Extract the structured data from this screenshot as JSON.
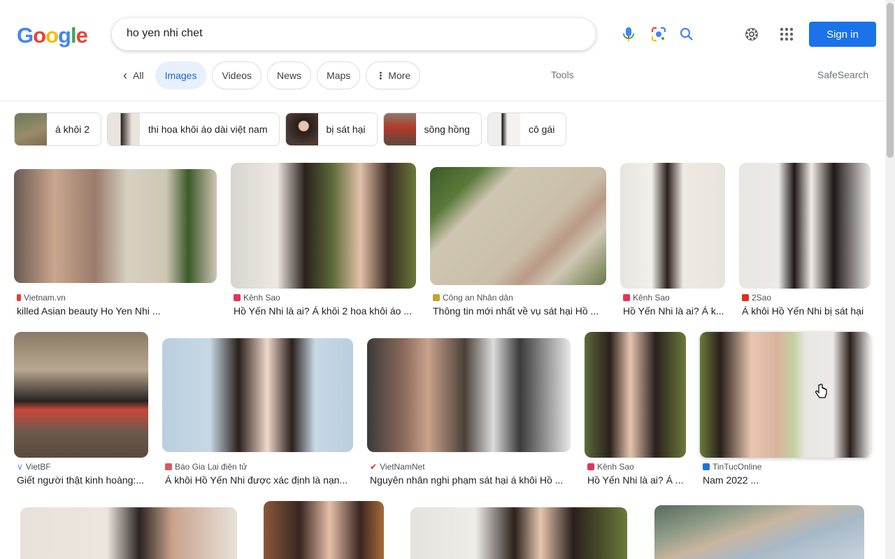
{
  "logo": {
    "letters": [
      "G",
      "o",
      "o",
      "g",
      "l",
      "e"
    ],
    "colors": [
      "#4285F4",
      "#EA4335",
      "#FBBC05",
      "#4285F4",
      "#34A853",
      "#EA4335"
    ]
  },
  "search": {
    "query": "ho yen nhi chet"
  },
  "header": {
    "sign_in": "Sign in"
  },
  "tabs": [
    {
      "label": "All"
    },
    {
      "label": "Images"
    },
    {
      "label": "Videos"
    },
    {
      "label": "News"
    },
    {
      "label": "Maps"
    },
    {
      "label": "More"
    }
  ],
  "tools_label": "Tools",
  "safesearch_label": "SafeSearch",
  "chips": [
    {
      "label": "á khôi 2"
    },
    {
      "label": "thi hoa khôi áo dài việt nam"
    },
    {
      "label": "bị sát hại"
    },
    {
      "label": "sông hồng"
    },
    {
      "label": "cô gái"
    }
  ],
  "results": [
    {
      "source": "Vietnam.vn",
      "title": "killed Asian beauty Ho Yen Nhi ..."
    },
    {
      "source": "Kênh Sao",
      "title": "Hồ Yến Nhi là ai? Á khôi 2 hoa khôi áo ..."
    },
    {
      "source": "Công an Nhân dân",
      "title": "Thông tin mới nhất về vụ sát hại Hồ ..."
    },
    {
      "source": "Kênh Sao",
      "title": "Hồ Yến Nhi là ai? Á k..."
    },
    {
      "source": "2Sao",
      "title": "Á khôi Hồ Yến Nhi bị sát hại"
    },
    {
      "source": "VietBF",
      "title": "Giết người thật kinh hoàng:..."
    },
    {
      "source": "Báo Gia Lai điện tử",
      "title": "Á khôi Hồ Yến Nhi được xác định là nạn..."
    },
    {
      "source": "VietNamNet",
      "title": "Nguyên nhân nghi phạm sát hại á khôi Hồ ..."
    },
    {
      "source": "Kênh Sao",
      "title": "Hồ Yến Nhi là ai? Á ..."
    },
    {
      "source": "TinTucOnline",
      "title": "Nam 2022 ..."
    }
  ],
  "colors": {
    "accent": "#1a73e8",
    "active_tab_bg": "#e8f0fe"
  }
}
